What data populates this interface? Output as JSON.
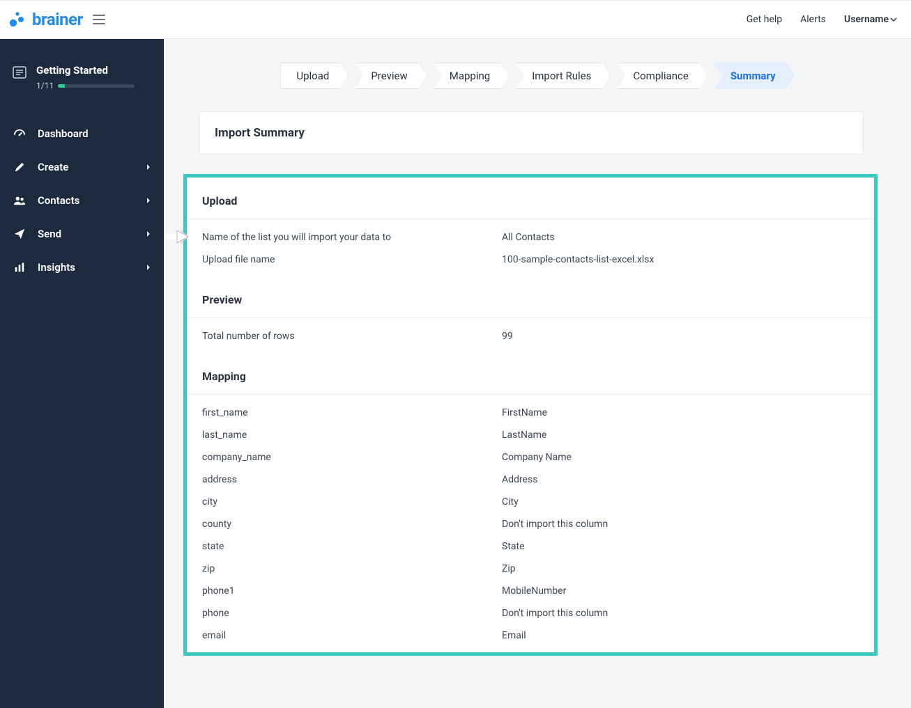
{
  "top": {
    "help": "Get help",
    "alerts": "Alerts",
    "username": "Username"
  },
  "sidebar": {
    "getting_started": {
      "title": "Getting Started",
      "progress_label": "1/11",
      "progress_pct": 9
    },
    "items": [
      {
        "label": "Dashboard",
        "has_children": false
      },
      {
        "label": "Create",
        "has_children": true
      },
      {
        "label": "Contacts",
        "has_children": true
      },
      {
        "label": "Send",
        "has_children": true
      },
      {
        "label": "Insights",
        "has_children": true
      }
    ]
  },
  "wizard": {
    "steps": [
      "Upload",
      "Preview",
      "Mapping",
      "Import Rules",
      "Compliance",
      "Summary"
    ],
    "active_index": 5
  },
  "page": {
    "title": "Import Summary"
  },
  "summary": {
    "upload": {
      "heading": "Upload",
      "rows": [
        {
          "key": "Name of the list you will import your data to",
          "val": "All Contacts"
        },
        {
          "key": "Upload file name",
          "val": "100-sample-contacts-list-excel.xlsx"
        }
      ]
    },
    "preview": {
      "heading": "Preview",
      "rows": [
        {
          "key": "Total number of rows",
          "val": "99"
        }
      ]
    },
    "mapping": {
      "heading": "Mapping",
      "rows": [
        {
          "key": "first_name",
          "val": "FirstName"
        },
        {
          "key": "last_name",
          "val": "LastName"
        },
        {
          "key": "company_name",
          "val": "Company Name"
        },
        {
          "key": "address",
          "val": "Address"
        },
        {
          "key": "city",
          "val": "City"
        },
        {
          "key": "county",
          "val": "Don't import this column"
        },
        {
          "key": "state",
          "val": "State"
        },
        {
          "key": "zip",
          "val": "Zip"
        },
        {
          "key": "phone1",
          "val": "MobileNumber"
        },
        {
          "key": "phone",
          "val": "Don't import this column"
        },
        {
          "key": "email",
          "val": "Email"
        }
      ]
    }
  }
}
